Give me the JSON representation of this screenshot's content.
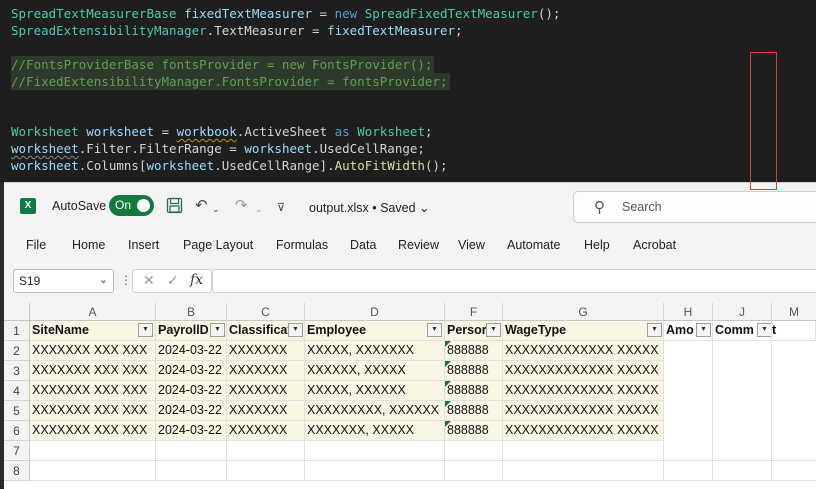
{
  "editor": {
    "lines": [
      [
        "SpreadTextMeasurerBase",
        " ",
        "fixedTextMeasurer",
        " = ",
        "new",
        " ",
        "SpreadFixedTextMeasurer",
        "();"
      ],
      [
        "SpreadExtensibilityManager",
        ".TextMeasurer = ",
        "fixedTextMeasurer",
        ";"
      ],
      "//FontsProviderBase fontsProvider = new FontsProvider();",
      "//FixedExtensibilityManager.FontsProvider = fontsProvider;",
      [
        "Worksheet",
        " ",
        "worksheet",
        " = ",
        "workbook",
        ".ActiveSheet ",
        "as",
        " ",
        "Worksheet",
        ";"
      ],
      [
        "worksheet",
        ".Filter.FilterRange = ",
        "worksheet",
        ".UsedCellRange;"
      ],
      [
        "worksheet",
        ".Columns[",
        "worksheet",
        ".UsedCellRange].",
        "AutoFitWidth",
        "();"
      ]
    ]
  },
  "titlebar": {
    "autosave_label": "AutoSave",
    "toggle_label": "On",
    "filename": "output.xlsx",
    "saved_status": "• Saved",
    "search_placeholder": "Search"
  },
  "menu": [
    "File",
    "Home",
    "Insert",
    "Page Layout",
    "Formulas",
    "Data",
    "Review",
    "View",
    "Automate",
    "Help",
    "Acrobat"
  ],
  "formula_bar": {
    "name_box": "S19",
    "fx": "fx",
    "formula": ""
  },
  "grid": {
    "columns": [
      "A",
      "B",
      "C",
      "D",
      "F",
      "G",
      "H",
      "J",
      "M"
    ],
    "rows": [
      "1",
      "2",
      "3",
      "4",
      "5",
      "6",
      "7",
      "8"
    ],
    "headers": [
      "SiteName",
      "PayrollD",
      "Classificat",
      "Employee",
      "Persor",
      "WageType",
      "Amo",
      "Comm"
    ],
    "header_overflow": "t",
    "data": [
      [
        "XXXXXXX XXX XXX",
        "2024-03-22",
        "XXXXXXX",
        "XXXXX, XXXXXXX",
        "888888",
        "XXXXXXXXXXXXX XXXXX"
      ],
      [
        "XXXXXXX XXX XXX",
        "2024-03-22",
        "XXXXXXX",
        "XXXXXX, XXXXX",
        "888888",
        "XXXXXXXXXXXXX XXXXX"
      ],
      [
        "XXXXXXX XXX XXX",
        "2024-03-22",
        "XXXXXXX",
        "XXXXX, XXXXXX",
        "888888",
        "XXXXXXXXXXXXX XXXXX"
      ],
      [
        "XXXXXXX XXX XXX",
        "2024-03-22",
        "XXXXXXX",
        "XXXXXXXXX, XXXXXX",
        "888888",
        "XXXXXXXXXXXXX XXXXX"
      ],
      [
        "XXXXXXX XXX XXX",
        "2024-03-22",
        "XXXXXXX",
        "XXXXXXX, XXXXX",
        "888888",
        "XXXXXXXXXXXXX XXXXX"
      ]
    ]
  },
  "colors": {
    "excel_green": "#107c41",
    "highlight": "#e0393e",
    "band": "#f8f6e3"
  }
}
